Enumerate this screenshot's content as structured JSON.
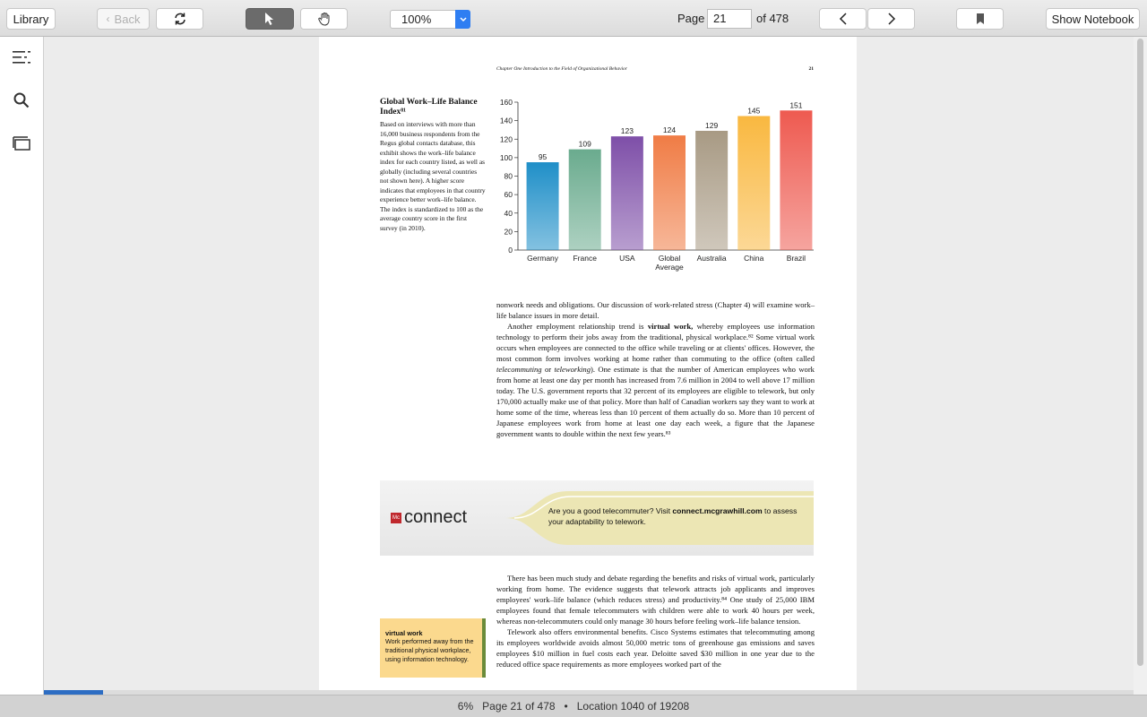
{
  "toolbar": {
    "library_label": "Library",
    "back_label": "Back",
    "zoom_value": "100%",
    "page_label": "Page",
    "page_value": "21",
    "page_total": "of 478",
    "show_notebook_label": "Show Notebook"
  },
  "sidebar": {
    "icons": [
      "table-of-contents-icon",
      "search-icon",
      "cards-icon"
    ]
  },
  "page": {
    "running_head": "Chapter One    Introduction to the Field of Organizational Behavior",
    "page_number": "21",
    "caption_title": "Global Work–Life Balance Index⁸¹",
    "caption_body": "Based on interviews with more than 16,000 business respondents from the Regus global contacts database, this exhibit shows the work–life balance index for each country listed, as well as globally (including several countries not shown here). A higher score indicates that employees in that country experience better work–life balance. The index is standardized to 100 as the average country score in the first survey (in 2010).",
    "para1": "nonwork needs and obligations. Our discussion of work-related stress (Chapter 4) will examine work–life balance issues in more detail.",
    "para2_a": "Another employment relationship trend is ",
    "para2_term": "virtual work,",
    "para2_b": " whereby employees use information technology to perform their jobs away from the traditional, physical workplace.⁸² Some virtual work occurs when employees are connected to the office while traveling or at clients' offices. However, the most common form involves working at home rather than commuting to the office (often called ",
    "para2_i1": "telecommuting",
    "para2_or": " or ",
    "para2_i2": "teleworking",
    "para2_c": "). One estimate is that the number of American employees who work from home at least one day per month has increased from 7.6 million in 2004 to well above 17 million today. The U.S. government reports that 32 percent of its employees are eligible to telework, but only 170,000 actually make use of that policy. More than half of Canadian workers say they want to work at home some of the time, whereas less than 10 percent of them actually do so. More than 10 percent of Japanese employees work from home at least one day each week, a figure that the Japanese government wants to double within the next few years.⁸³",
    "connect_logo": "connect",
    "connect_logo_mark": "Mc Graw Hill",
    "connect_text_a": "Are you a good telecommuter? Visit ",
    "connect_link": "connect.mcgrawhill.com",
    "connect_text_b": " to assess your adaptability to telework.",
    "para3": "There has been much study and debate regarding the benefits and risks of virtual work, particularly working from home. The evidence suggests that telework attracts job applicants and improves employees' work–life balance (which reduces stress) and productivity.⁸⁴ One study of 25,000 IBM employees found that female telecommuters with children were able to work 40 hours per week, whereas non-telecommuters could only manage 30 hours before feeling work–life balance tension.",
    "para4": "Telework also offers environmental benefits. Cisco Systems estimates that telecommuting among its employees worldwide avoids almost 50,000 metric tons of greenhouse gas emissions and saves employees $10 million in fuel costs each year. Deloitte saved $30 million in one year due to the reduced office space requirements as more employees worked part of the",
    "margin_term": "virtual work",
    "margin_def": "Work performed away from the traditional physical workplace, using information technology."
  },
  "chart_data": {
    "type": "bar",
    "title": "",
    "categories": [
      "Germany",
      "France",
      "USA",
      "Global Average",
      "Australia",
      "China",
      "Brazil"
    ],
    "category_lines": [
      [
        "Germany"
      ],
      [
        "France"
      ],
      [
        "USA"
      ],
      [
        "Global",
        "Average"
      ],
      [
        "Australia"
      ],
      [
        "China"
      ],
      [
        "Brazil"
      ]
    ],
    "values": [
      95,
      109,
      123,
      124,
      129,
      145,
      151
    ],
    "colors": [
      "#1f8fc8",
      "#6aab8e",
      "#7e4fa8",
      "#f07c45",
      "#a89a84",
      "#f9b840",
      "#ee5a50"
    ],
    "ylim": [
      0,
      160
    ],
    "yticks": [
      0,
      20,
      40,
      60,
      80,
      100,
      120,
      140,
      160
    ],
    "xlabel": "",
    "ylabel": ""
  },
  "status": {
    "percent": "6%",
    "page_info": "Page 21 of 478",
    "separator": "•",
    "location": "Location 1040 of 19208",
    "progress_fraction": 0.054
  }
}
